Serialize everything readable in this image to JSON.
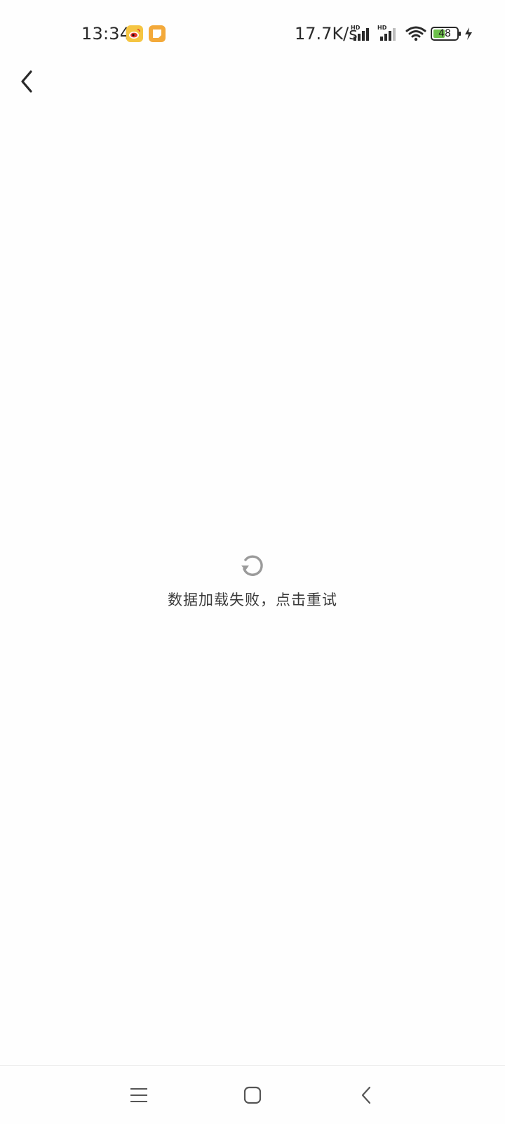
{
  "status_bar": {
    "time": "13:34",
    "net_speed": "17.7K/s",
    "battery_level": "48",
    "notification_icons": [
      "weibo-icon",
      "memo-icon"
    ],
    "signal_icons": [
      "hd-signal-icon",
      "hd-signal-icon"
    ],
    "wifi_icon": "wifi-icon",
    "charging": true
  },
  "header": {
    "back_icon": "chevron-left-icon"
  },
  "error_state": {
    "icon": "refresh-icon",
    "message": "数据加载失败，点击重试"
  },
  "nav_bar": {
    "buttons": [
      "menu-icon",
      "home-icon",
      "back-icon"
    ]
  },
  "colors": {
    "background": "#fefefe",
    "text": "#3a3a3a",
    "icon_gray": "#9a9a9a",
    "battery_green": "#6cc04a"
  }
}
